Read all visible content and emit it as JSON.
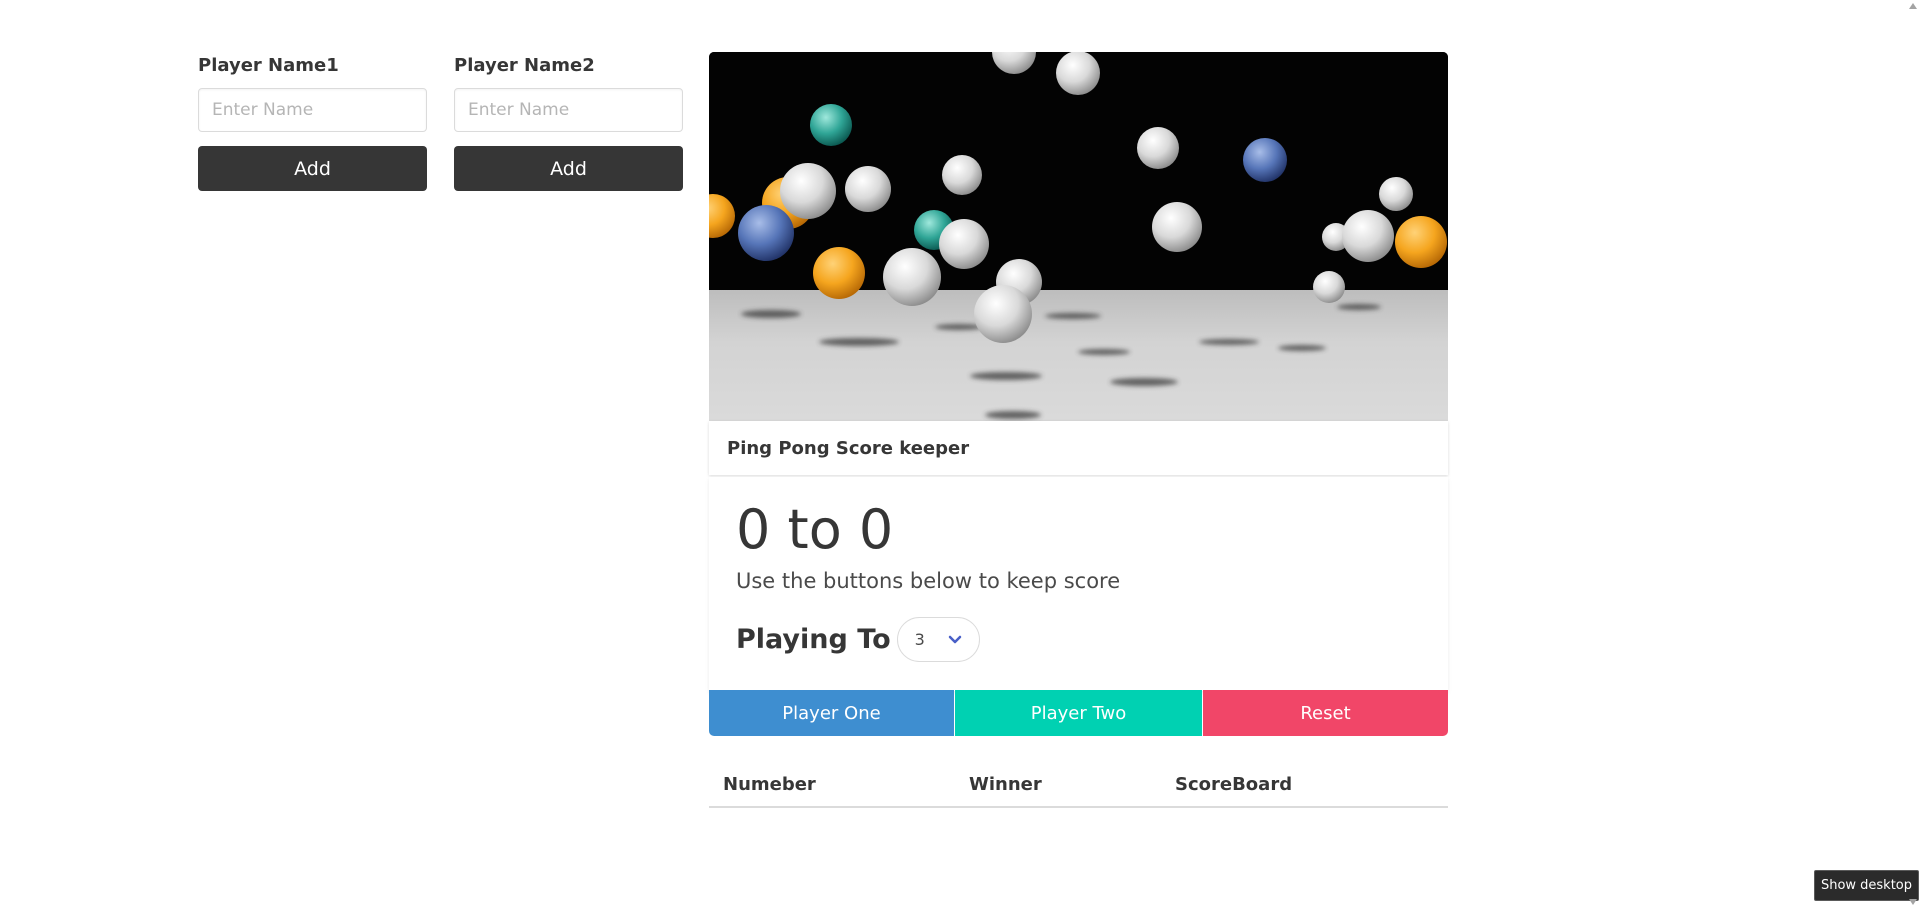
{
  "players": [
    {
      "label": "Player Name1",
      "placeholder": "Enter Name",
      "value": "",
      "add_label": "Add"
    },
    {
      "label": "Player Name2",
      "placeholder": "Enter Name",
      "value": "",
      "add_label": "Add"
    }
  ],
  "card": {
    "image_icon": "ping-pong-balls-image",
    "title": "Ping Pong Score keeper",
    "score": "0 to 0",
    "subtitle": "Use the buttons below to keep score",
    "playing_to_label": "Playing To",
    "playing_to_value": "3"
  },
  "buttons": {
    "player_one": "Player One",
    "player_two": "Player Two",
    "reset": "Reset"
  },
  "history": {
    "columns": [
      "Numeber",
      "Winner",
      "ScoreBoard"
    ],
    "rows": []
  },
  "tooltip": "Show desktop",
  "colors": {
    "dark": "#363636",
    "info": "#3e8ed0",
    "primary": "#00d1b2",
    "danger": "#f14668",
    "select_arrow": "#485fc7"
  }
}
